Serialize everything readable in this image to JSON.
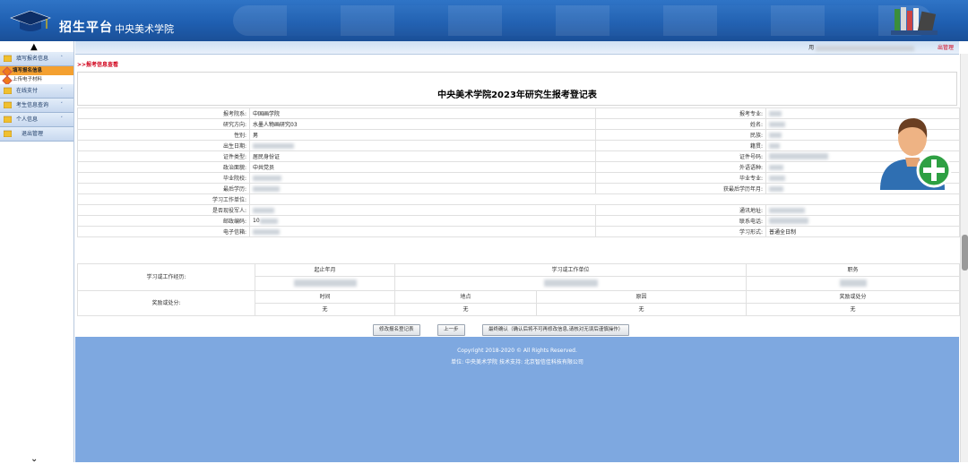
{
  "header": {
    "brand": "招生平台",
    "school": "中央美术学院"
  },
  "topbar": {
    "user_prefix": "用",
    "logout": "出管理"
  },
  "sidebar": {
    "items": [
      {
        "label": "填写报名信息",
        "arrow": "˄"
      },
      {
        "label": "在线支付",
        "arrow": "˅"
      },
      {
        "label": "考生信息查询",
        "arrow": "˅"
      },
      {
        "label": "个人信息",
        "arrow": "˅"
      },
      {
        "label": "退出管理",
        "arrow": ""
      }
    ],
    "subitems": [
      "填写报名信息",
      "上传电子材料"
    ]
  },
  "breadcrumb": ">>报考信息查看",
  "page_title": "中央美术学院2023年研究生报考登记表",
  "fields": {
    "dept": {
      "label": "报考院系:",
      "value": "中国画学院"
    },
    "major": {
      "label": "报考专业:",
      "value": ""
    },
    "direction": {
      "label": "研究方向:",
      "value": "水墨人物画研究03"
    },
    "name": {
      "label": "姓名:",
      "value": ""
    },
    "gender": {
      "label": "性别:",
      "value": "男"
    },
    "ethnic": {
      "label": "民族:",
      "value": ""
    },
    "birth": {
      "label": "出生日期:",
      "value": ""
    },
    "native": {
      "label": "籍贯:",
      "value": ""
    },
    "idtype": {
      "label": "证件类型:",
      "value": "居民身份证"
    },
    "idno": {
      "label": "证件号码:",
      "value": ""
    },
    "politics": {
      "label": "政治面貌:",
      "value": "中共党员"
    },
    "lang": {
      "label": "外语语种:",
      "value": ""
    },
    "school": {
      "label": "毕业院校:",
      "value": ""
    },
    "gradmajor": {
      "label": "毕业专业:",
      "value": ""
    },
    "edu": {
      "label": "最后学历:",
      "value": ""
    },
    "edudate": {
      "label": "获最后学历年月:",
      "value": ""
    },
    "work": {
      "label": "学习工作单位:",
      "value": ""
    },
    "soldier": {
      "label": "是否现役军人:",
      "value": ""
    },
    "address": {
      "label": "通讯地址:",
      "value": ""
    },
    "zip": {
      "label": "邮政编码:",
      "value": "10"
    },
    "phone": {
      "label": "联系电话:",
      "value": ""
    },
    "email": {
      "label": "电子信箱:",
      "value": ""
    },
    "studyform": {
      "label": "学习形式:",
      "value": "普通全日制"
    }
  },
  "experience": {
    "label": "学习或工作经历:",
    "headers": [
      "起止年月",
      "学习或工作单位",
      "职务"
    ]
  },
  "awards": {
    "label": "奖励或处分:",
    "headers": [
      "时间",
      "地点",
      "原因",
      "奖励或处分"
    ],
    "row": [
      "无",
      "无",
      "无",
      "无"
    ]
  },
  "buttons": {
    "edit": "修改报名登记表",
    "prev": "上一步",
    "confirm": "最终确认（确认后将不可再修改信息,请核对无误后谨慎操作）"
  },
  "footer": {
    "copyright": "Copyright 2018-2020 © All Rights Reserved.",
    "unit": "单位: 中央美术学院    技术支持: 北京智信佳科技有限公司"
  },
  "colors": {
    "header": "#1f5fb1",
    "footer": "#7ea8e0",
    "accent": "#d0021b",
    "active_menu": "#f4a030"
  }
}
